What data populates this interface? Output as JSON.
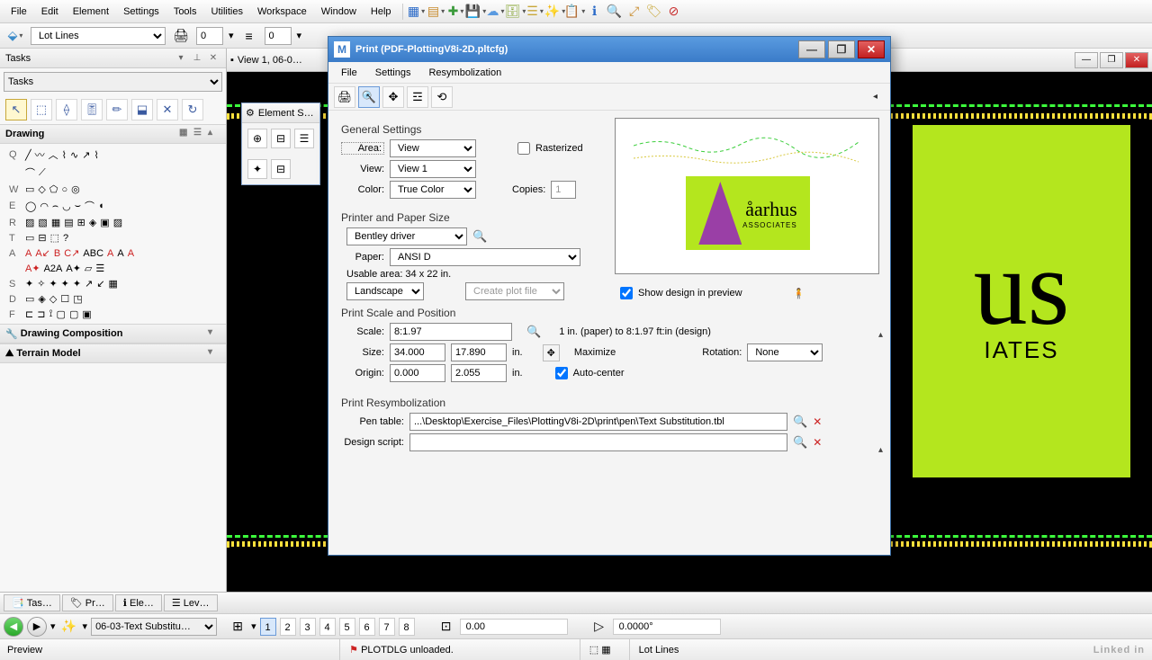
{
  "menubar": [
    "File",
    "Edit",
    "Element",
    "Settings",
    "Tools",
    "Utilities",
    "Workspace",
    "Window",
    "Help"
  ],
  "level_combo": "Lot Lines",
  "spinner1": "0",
  "spinner2": "0",
  "tasks": {
    "title": "Tasks",
    "combo": "Tasks",
    "drawing_header": "Drawing",
    "composition": "Drawing Composition",
    "terrain": "Terrain Model"
  },
  "view": {
    "title": "View 1, 06-0…"
  },
  "element_panel": {
    "title": "Element S…"
  },
  "print": {
    "title": "Print  (PDF-PlottingV8i-2D.pltcfg)",
    "menu": [
      "File",
      "Settings",
      "Resymbolization"
    ],
    "general": {
      "header": "General Settings",
      "area_label": "Area:",
      "area": "View",
      "view_label": "View:",
      "view": "View 1",
      "color_label": "Color:",
      "color": "True Color",
      "rasterized": "Rasterized",
      "copies_label": "Copies:",
      "copies": "1"
    },
    "printer": {
      "header": "Printer and Paper Size",
      "driver": "Bentley driver",
      "paper_label": "Paper:",
      "paper": "ANSI D",
      "usable": "Usable area:  34 x 22 in.",
      "orientation": "Landscape",
      "create_plot": "Create plot file",
      "show_design": "Show design in preview"
    },
    "scale": {
      "header": "Print Scale and Position",
      "scale_label": "Scale:",
      "scale": "8:1.97",
      "scale_desc": "1 in. (paper) to 8:1.97 ft:in (design)",
      "size_label": "Size:",
      "size_w": "34.000",
      "size_h": "17.890",
      "unit": "in.",
      "maximize": "Maximize",
      "origin_label": "Origin:",
      "origin_x": "0.000",
      "origin_y": "2.055",
      "autocenter": "Auto-center",
      "rotation_label": "Rotation:",
      "rotation": "None"
    },
    "resym": {
      "header": "Print Resymbolization",
      "pentable_label": "Pen table:",
      "pentable": "...\\Desktop\\Exercise_Files\\PlottingV8i-2D\\print\\pen\\Text Substitution.tbl",
      "script_label": "Design script:",
      "script": ""
    },
    "preview_logo_text": "åarhus",
    "preview_logo_sub": "ASSOCIATES"
  },
  "bottom_tabs": [
    "Tas…",
    "Pr…",
    "Ele…",
    "Lev…"
  ],
  "status": {
    "model_combo": "06-03-Text Substitu…",
    "views": [
      "1",
      "2",
      "3",
      "4",
      "5",
      "6",
      "7",
      "8"
    ],
    "coord1": "0.00",
    "coord2": "0.0000°",
    "preview": "Preview",
    "message": "PLOTDLG unloaded.",
    "level": "Lot Lines",
    "brand": "Linked in"
  }
}
